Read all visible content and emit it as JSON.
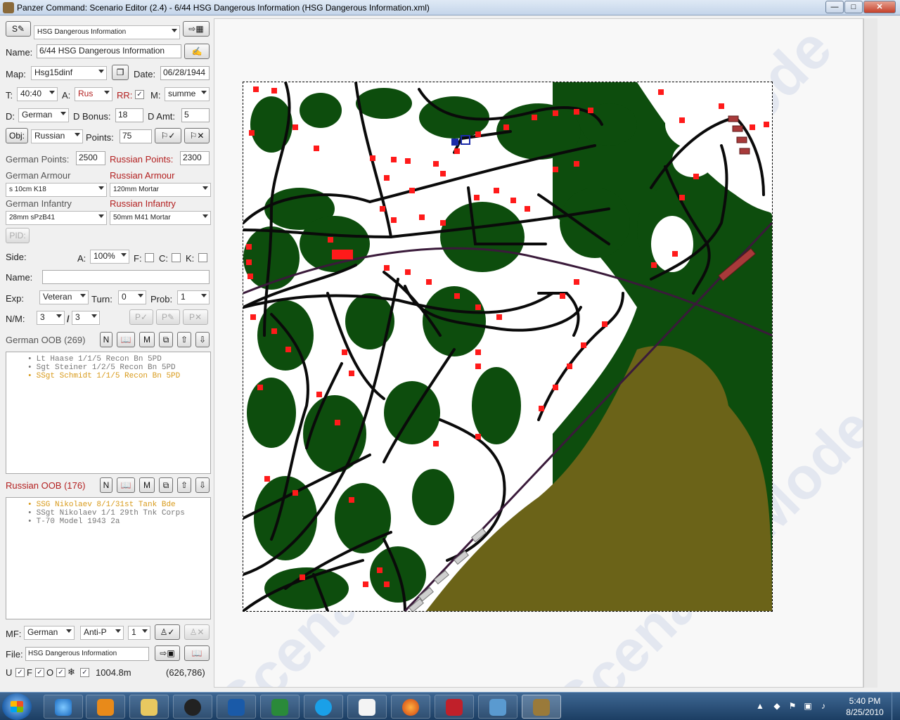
{
  "window": {
    "title": "Panzer Command: Scenario Editor (2.4) - 6/44 HSG Dangerous Information (HSG Dangerous Information.xml)",
    "minimize": "—",
    "maximize": "□",
    "close": "✕"
  },
  "scenario": {
    "select_button": "S",
    "selected": "HSG Dangerous Information",
    "name_label": "Name:",
    "name_value": "6/44 HSG Dangerous Information",
    "map_label": "Map:",
    "map_value": "Hsg15dinf",
    "date_label": "Date:",
    "date_value": "06/28/1944",
    "t_label": "T:",
    "t_value": "40:40",
    "a_label": "A:",
    "a_value": "Rus",
    "rr_label": "RR:",
    "m_label": "M:",
    "m_value": "summe",
    "d_label": "D:",
    "d_value": "German",
    "d_bonus_label": "D Bonus:",
    "d_bonus_value": "18",
    "d_amt_label": "D Amt:",
    "d_amt_value": "5",
    "obj_button": "Obj:",
    "obj_side": "Russian",
    "points_label": "Points:",
    "points_value": "75"
  },
  "forces": {
    "german_points_label": "German Points:",
    "german_points_value": "2500",
    "russian_points_label": "Russian Points:",
    "russian_points_value": "2300",
    "german_armour_label": "German Armour",
    "german_armour_value": "s 10cm K18",
    "russian_armour_label": "Russian Armour",
    "russian_armour_value": "120mm Mortar",
    "german_infantry_label": "German Infantry",
    "german_infantry_value": "28mm sPzB41",
    "russian_infantry_label": "Russian Infantry",
    "russian_infantry_value": "50mm M41 Mortar"
  },
  "unit": {
    "pid_button": "PID:",
    "side_label": "Side:",
    "a_label": "A:",
    "a_value": "100%",
    "f_label": "F:",
    "c_label": "C:",
    "k_label": "K:",
    "name_label": "Name:",
    "name_value": "",
    "exp_label": "Exp:",
    "exp_value": "Veteran",
    "turn_label": "Turn:",
    "turn_value": "0",
    "prob_label": "Prob:",
    "prob_value": "1",
    "nm_label": "N/M:",
    "n_value": "3",
    "m_value": "3",
    "slash": "/",
    "pv_button": "P✓",
    "pe_button": "P✎",
    "px_button": "P✕"
  },
  "german_oob": {
    "label": "German OOB (269)",
    "items": [
      {
        "text": "Lt Haase 1/1/5 Recon Bn 5PD"
      },
      {
        "text": "Sgt Steiner 1/2/5 Recon Bn 5PD"
      },
      {
        "text": "SSgt Schmidt 1/1/5 Recon Bn 5PD"
      }
    ]
  },
  "russian_oob": {
    "label": "Russian OOB (176)",
    "items": [
      {
        "text": "SSG Nikolaev 8/1/31st Tank Bde"
      },
      {
        "text": "SSgt Nikolaev 1/1 29th Tnk Corps"
      },
      {
        "text": "T-70 Model 1943 2a"
      }
    ]
  },
  "oob_buttons": {
    "n": "N",
    "book": "📖",
    "m": "M",
    "copy": "⧉",
    "up": "⇧",
    "down": "⇩"
  },
  "bottom": {
    "mf_label": "MF:",
    "mf_side": "German",
    "mf_type": "Anti-P",
    "mf_count": "1",
    "file_label": "File:",
    "file_value": "HSG Dangerous Information",
    "u_label": "U",
    "f_label": "F",
    "o_label": "O",
    "star_label": "❄",
    "distance": "1004.8m",
    "coords": "(626,786)"
  },
  "watermark_text": "Scenario Mode",
  "colors": {
    "forest": "#0d4d0d",
    "swamp": "#6b6318",
    "road": "#0a0a0a",
    "building": "#ff1a1a",
    "railway": "#3a1a3a"
  },
  "taskbar": {
    "time": "5:40 PM",
    "date": "8/25/2010",
    "items": [
      {
        "name": "internet-explorer"
      },
      {
        "name": "media-player"
      },
      {
        "name": "file-explorer"
      },
      {
        "name": "hp"
      },
      {
        "name": "chart-app"
      },
      {
        "name": "excel"
      },
      {
        "name": "skype"
      },
      {
        "name": "solitaire"
      },
      {
        "name": "firefox"
      },
      {
        "name": "psp8"
      },
      {
        "name": "photo-viewer"
      },
      {
        "name": "scenario-editor"
      }
    ]
  }
}
